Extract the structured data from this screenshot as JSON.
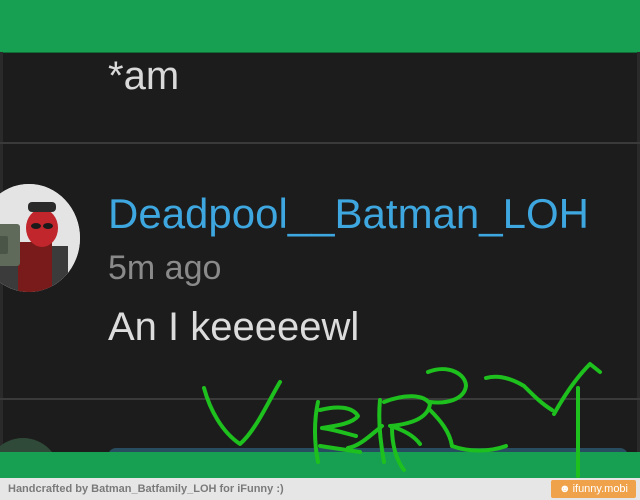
{
  "comment_thread": {
    "previous_comment": {
      "text": "*am"
    },
    "comment": {
      "username": "Deadpool__Batman_LOH",
      "timestamp": "5m ago",
      "text": "An I keeeeewl"
    }
  },
  "doodle": {
    "text": "VERY",
    "color": "#1ec01e"
  },
  "colors": {
    "accent_green": "#17a052",
    "username_blue": "#3ea7e0",
    "background": "#1c1c1c",
    "badge_orange": "#f0a24a"
  },
  "footer": {
    "credit": "Handcrafted by Batman_Batfamily_LOH for iFunny :)",
    "badge_icon": "smiley-icon",
    "badge_glyph": "☻",
    "badge_text": "ifunny.mobi"
  }
}
